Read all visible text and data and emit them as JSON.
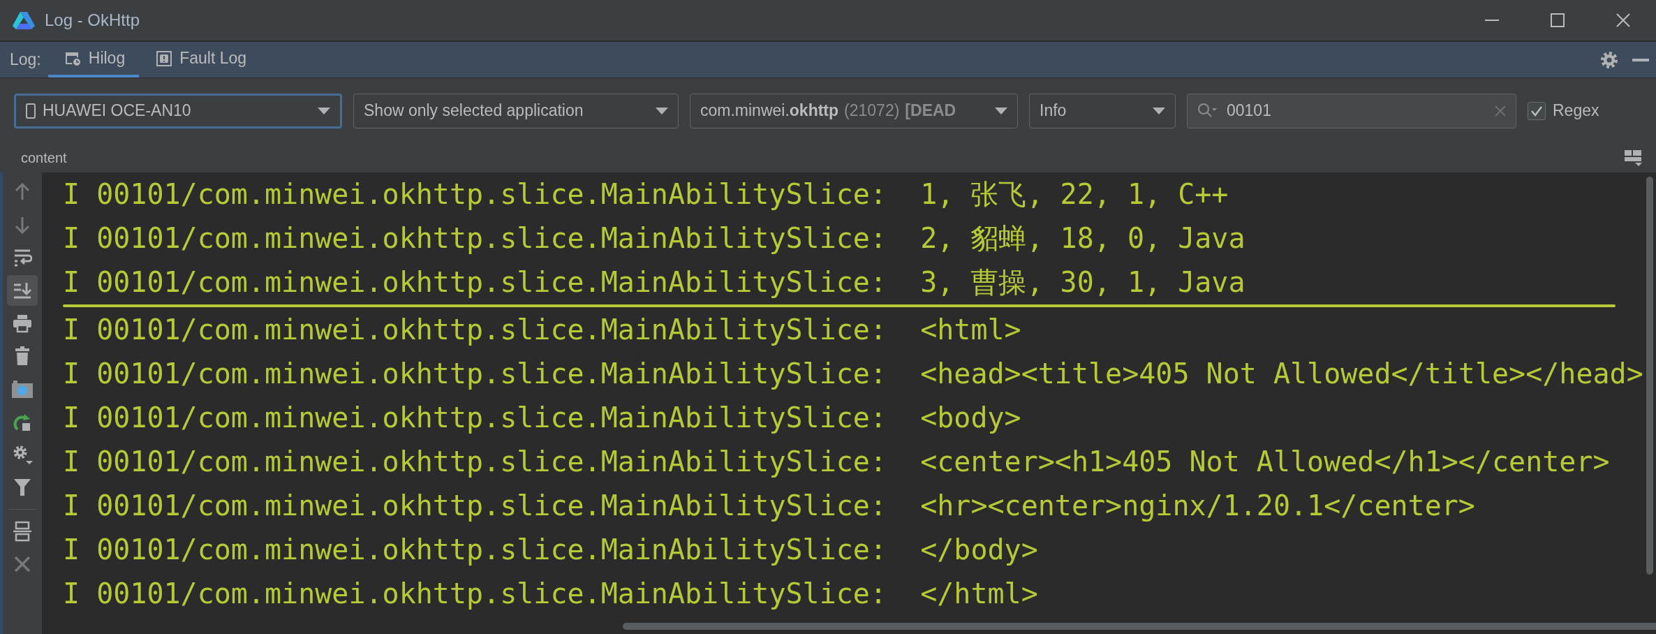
{
  "window": {
    "title": "Log - OkHttp"
  },
  "log_tabs": {
    "label": "Log:",
    "tabs": [
      {
        "label": "Hilog",
        "selected": true,
        "kind": "hilog"
      },
      {
        "label": "Fault Log",
        "selected": false,
        "kind": "fault"
      }
    ]
  },
  "filters": {
    "device": {
      "value": "HUAWEI OCE-AN10",
      "focused": true
    },
    "scope": {
      "value": "Show only selected application"
    },
    "process": {
      "name": "com.minwei.**okhttp**",
      "pid": "(21072)",
      "status": "[DEAD"
    },
    "level": {
      "value": "Info"
    },
    "search": {
      "value": "00101"
    },
    "regex": {
      "label": "Regex",
      "checked": true
    }
  },
  "header": {
    "label": "content"
  },
  "tools": [
    {
      "kind": "up",
      "selected": false,
      "disabled": true
    },
    {
      "kind": "down",
      "selected": false,
      "disabled": true
    },
    {
      "kind": "wrap",
      "selected": false,
      "disabled": false
    },
    {
      "kind": "scrollend",
      "selected": true,
      "disabled": false
    },
    {
      "kind": "print",
      "selected": false,
      "disabled": false
    },
    {
      "kind": "trash",
      "selected": false,
      "disabled": false
    },
    {
      "kind": "camera",
      "selected": false,
      "disabled": false
    },
    {
      "kind": "restart",
      "selected": false,
      "disabled": false
    },
    {
      "kind": "settings",
      "selected": false,
      "disabled": false
    },
    {
      "kind": "filter",
      "selected": false,
      "disabled": false
    },
    {
      "kind": "split",
      "selected": false,
      "disabled": false
    },
    {
      "kind": "close",
      "selected": false,
      "disabled": true
    }
  ],
  "log": [
    {
      "level": "I",
      "tag": "00101/com.minwei.okhttp.slice.MainAbilitySlice:",
      "message": "1, 张飞, 22, 1, C++",
      "divider_below": false
    },
    {
      "level": "I",
      "tag": "00101/com.minwei.okhttp.slice.MainAbilitySlice:",
      "message": "2, 貂蝉, 18, 0, Java",
      "divider_below": false
    },
    {
      "level": "I",
      "tag": "00101/com.minwei.okhttp.slice.MainAbilitySlice:",
      "message": "3, 曹操, 30, 1, Java",
      "divider_below": true
    },
    {
      "level": "I",
      "tag": "00101/com.minwei.okhttp.slice.MainAbilitySlice:",
      "message": "<html>",
      "divider_below": false
    },
    {
      "level": "I",
      "tag": "00101/com.minwei.okhttp.slice.MainAbilitySlice:",
      "message": "<head><title>405 Not Allowed</title></head>",
      "divider_below": false
    },
    {
      "level": "I",
      "tag": "00101/com.minwei.okhttp.slice.MainAbilitySlice:",
      "message": "<body>",
      "divider_below": false
    },
    {
      "level": "I",
      "tag": "00101/com.minwei.okhttp.slice.MainAbilitySlice:",
      "message": "<center><h1>405 Not Allowed</h1></center>",
      "divider_below": false
    },
    {
      "level": "I",
      "tag": "00101/com.minwei.okhttp.slice.MainAbilitySlice:",
      "message": "<hr><center>nginx/1.20.1</center>",
      "divider_below": false
    },
    {
      "level": "I",
      "tag": "00101/com.minwei.okhttp.slice.MainAbilitySlice:",
      "message": "</body>",
      "divider_below": false
    },
    {
      "level": "I",
      "tag": "00101/com.minwei.okhttp.slice.MainAbilitySlice:",
      "message": "</html>",
      "divider_below": false
    }
  ]
}
